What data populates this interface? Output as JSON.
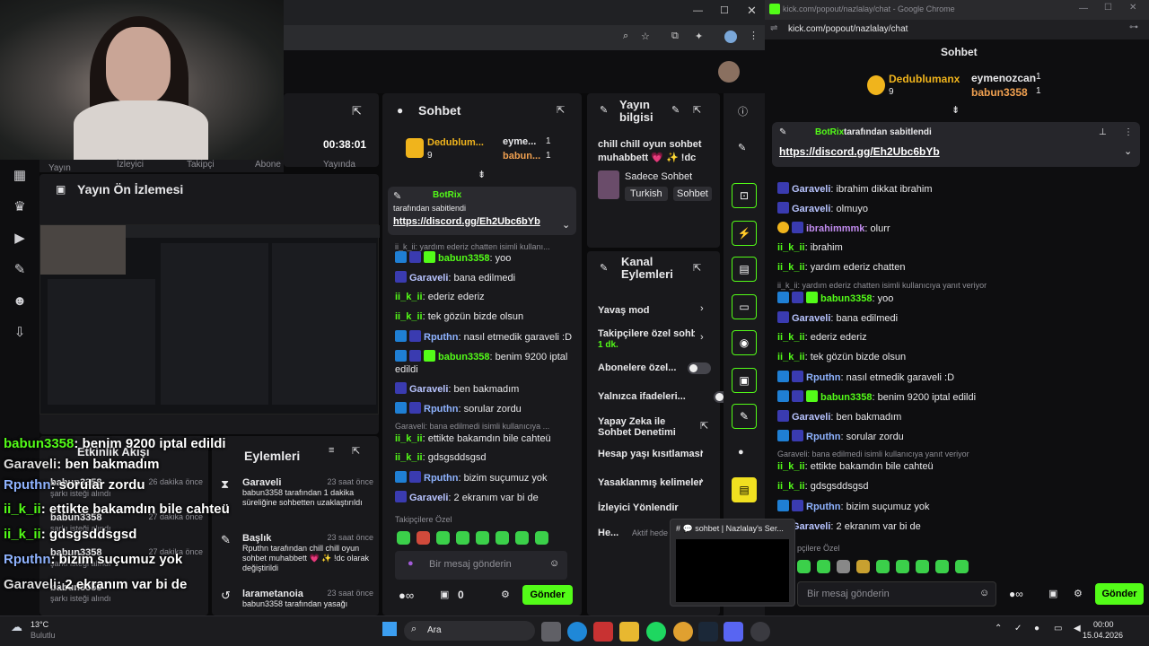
{
  "webcam": {
    "label": "webcam"
  },
  "dashboard": {
    "time": "00:38:01",
    "stats": [
      "Yayın",
      "İzleyici",
      "Takipçi",
      "Abone",
      "Yayında"
    ],
    "preview_title": "Yayın Ön İzlemesi",
    "activity_title": "Etkinlik Akışı",
    "actions_title": "Eylemleri"
  },
  "chat_mid": {
    "title": "Sohbet",
    "top_users": [
      {
        "name": "Dedublum...",
        "count": "9"
      },
      {
        "name": "eyme...",
        "count": "1"
      },
      {
        "name": "babun...",
        "count": "1"
      }
    ],
    "pinned_by": "BotRix",
    "pinned_label": "tarafından sabitlendi",
    "pinned_link": "https://discord.gg/Eh2Ubc6bYb",
    "reply_note": "ii_k_ii: yardım ederiz chatten isimli kullanı...",
    "messages": [
      {
        "user": "babun3358",
        "text": "yoo"
      },
      {
        "user": "Garaveli",
        "text": "bana edilmedi"
      },
      {
        "user": "ii_k_ii",
        "text": "ederiz ederiz"
      },
      {
        "user": "ii_k_ii",
        "text": "tek gözün bizde olsun"
      },
      {
        "user": "Rputhn",
        "text": "nasıl etmedik garaveli :D"
      },
      {
        "user": "babun3358",
        "text": "benim 9200 iptal edildi"
      },
      {
        "user": "Garaveli",
        "text": "ben bakmadım"
      },
      {
        "user": "Rputhn",
        "text": "sorular zordu"
      },
      {
        "user": "",
        "text": "Garaveli: bana edilmedi isimli kullanıcıya ..."
      },
      {
        "user": "ii_k_ii",
        "text": "ettikte bakamdın bile cahteü"
      },
      {
        "user": "ii_k_ii",
        "text": "gdsgsddsgsd"
      },
      {
        "user": "Rputhn",
        "text": "bizim suçumuz yok"
      },
      {
        "user": "Garaveli",
        "text": "2 ekranım var bi de"
      }
    ],
    "emote_label": "Takipçilere Özel",
    "input_placeholder": "Bir mesaj gönderin",
    "count": "0",
    "send": "Gönder"
  },
  "stream_info": {
    "title": "Yayın bilgisi",
    "desc": "chill chill oyun sohbet muhabbett 💗 ✨ !dc",
    "category": "Sadece Sohbet",
    "tags": [
      "Turkish",
      "Sohbet"
    ]
  },
  "channel_actions": {
    "title": "Kanal Eylemleri",
    "items": [
      "Yavaş mod",
      "Takipçilere özel sohbe",
      "Abonelere özel...",
      "Yalnızca ifadeleri...",
      "Yapay Zeka ile Sohbet Denetimi",
      "Hesap yaşı kısıtlaması",
      "Yasaklanmış kelimeler",
      "İzleyici Yönlendir",
      "He..."
    ],
    "sub": "1 dk.",
    "status": "Aktif hede"
  },
  "activity": [
    {
      "name": "babun3358",
      "time": "26 dakika önce",
      "sub": "şarkı isteği alındı"
    },
    {
      "name": "babun3358",
      "time": "27 dakika önce",
      "sub": "şarkı isteği alındı"
    },
    {
      "name": "babun3358",
      "time": "27 dakika önce",
      "sub": "şarkı isteği alındı"
    },
    {
      "name": "babun3358",
      "time": "",
      "sub": "şarkı isteği alındı"
    }
  ],
  "actions": [
    {
      "title": "Garaveli",
      "time": "23 saat önce",
      "desc": "babun3358 tarafından 1 dakika süreliğine sohbetten uzaklaştırıldı"
    },
    {
      "title": "Başlık",
      "time": "23 saat önce",
      "desc": "Rputhn tarafından chill chill oyun sohbet muhabbett 💗 ✨ !dc olarak değiştirildi"
    },
    {
      "title": "larametanoia",
      "time": "23 saat önce",
      "desc": "babun3358 tarafından yasağı"
    }
  ],
  "overlay_chat": [
    {
      "user": "babun3358",
      "text": ": benim 9200 iptal edildi"
    },
    {
      "user": "Garaveli",
      "text": ": ben bakmadım"
    },
    {
      "user": "Rputhn",
      "text": ": sorular zordu"
    },
    {
      "user": "ii_k_ii",
      "text": ": ettikte bakamdın bile cahteü"
    },
    {
      "user": "ii_k_ii",
      "text": ": gdsgsddsgsd"
    },
    {
      "user": "Rputhn",
      "text": ": bizim suçumuz yok"
    },
    {
      "user": "Garaveli",
      "text": ": 2 ekranım var bi de"
    }
  ],
  "popout": {
    "window_title": "kick.com/popout/nazlalay/chat - Google Chrome",
    "url": "kick.com/popout/nazlalay/chat",
    "title": "Sohbet",
    "top_users": [
      {
        "name": "Dedublumanx",
        "count": "9"
      },
      {
        "name": "eymenozcan",
        "count": "1"
      },
      {
        "name": "babun3358",
        "count": "1"
      }
    ],
    "pinned_by": "BotRix",
    "pinned_label": "tarafından sabitlendi",
    "pinned_link": "https://discord.gg/Eh2Ubc6bYb",
    "messages": [
      {
        "user": "Garaveli",
        "text": "ibrahim dikkat ibrahim"
      },
      {
        "user": "Garaveli",
        "text": "olmuyo"
      },
      {
        "user": "ibrahimmmk",
        "text": "olurr"
      },
      {
        "user": "ii_k_ii",
        "text": "ibrahim"
      },
      {
        "user": "ii_k_ii",
        "text": "yardım ederiz chatten"
      },
      {
        "user": "",
        "text": "ii_k_ii: yardım ederiz chatten isimli kullanıcıya yanıt veriyor"
      },
      {
        "user": "babun3358",
        "text": "yoo"
      },
      {
        "user": "Garaveli",
        "text": "bana edilmedi"
      },
      {
        "user": "ii_k_ii",
        "text": "ederiz ederiz"
      },
      {
        "user": "ii_k_ii",
        "text": "tek gözün bizde olsun"
      },
      {
        "user": "Rputhn",
        "text": "nasıl etmedik garaveli :D"
      },
      {
        "user": "babun3358",
        "text": "benim 9200 iptal edildi"
      },
      {
        "user": "Garaveli",
        "text": "ben bakmadım"
      },
      {
        "user": "Rputhn",
        "text": "sorular zordu"
      },
      {
        "user": "",
        "text": "Garaveli: bana edilmedi isimli kullanıcıya yanıt veriyor"
      },
      {
        "user": "ii_k_ii",
        "text": "ettikte bakamdın bile cahteü"
      },
      {
        "user": "ii_k_ii",
        "text": "gdsgsddsgsd"
      },
      {
        "user": "Rputhn",
        "text": "bizim suçumuz yok"
      },
      {
        "user": "Garaveli",
        "text": "2 ekranım var bi de"
      }
    ],
    "emote_label": "pçilere Özel",
    "input_placeholder": "Bir mesaj gönderin",
    "send": "Gönder"
  },
  "discord_preview": {
    "title": "# 💬 sohbet | Nazlalay's Ser..."
  },
  "taskbar": {
    "temp": "13°C",
    "weather": "Bulutlu",
    "search": "Ara",
    "time": "00:00",
    "date": "15.04.2026"
  }
}
